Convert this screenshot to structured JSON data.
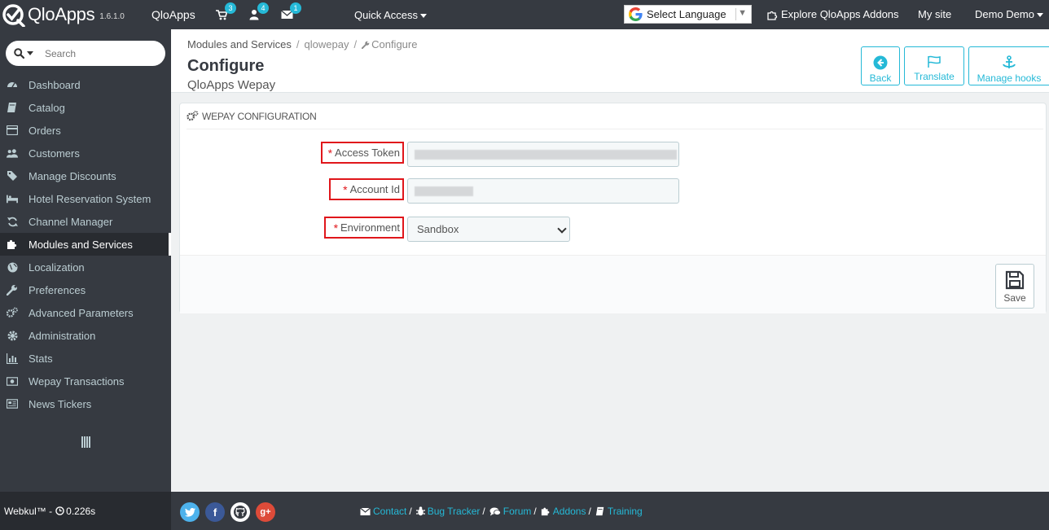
{
  "topbar": {
    "logo_text": "QloApps",
    "version": "1.6.1.0",
    "shop_name": "QloApps",
    "notifications": [
      {
        "icon": "cart-icon",
        "count": "3"
      },
      {
        "icon": "user-icon",
        "count": "4"
      },
      {
        "icon": "envelope-icon",
        "count": "1"
      }
    ],
    "quick_access": "Quick Access",
    "language_select": "Select Language",
    "explore_addons": "Explore QloApps Addons",
    "my_site": "My site",
    "employee": "Demo Demo"
  },
  "sidebar": {
    "search_placeholder": "Search",
    "items": [
      {
        "label": "Dashboard",
        "icon": "dashboard-icon"
      },
      {
        "label": "Catalog",
        "icon": "book-icon"
      },
      {
        "label": "Orders",
        "icon": "credit-card-icon"
      },
      {
        "label": "Customers",
        "icon": "users-icon"
      },
      {
        "label": "Manage Discounts",
        "icon": "tags-icon"
      },
      {
        "label": "Hotel Reservation System",
        "icon": "bed-icon"
      },
      {
        "label": "Channel Manager",
        "icon": "refresh-icon"
      },
      {
        "label": "Modules and Services",
        "icon": "puzzle-icon",
        "active": true
      },
      {
        "label": "Localization",
        "icon": "globe-icon"
      },
      {
        "label": "Preferences",
        "icon": "wrench-icon"
      },
      {
        "label": "Advanced Parameters",
        "icon": "cogs-icon"
      },
      {
        "label": "Administration",
        "icon": "cog-icon"
      },
      {
        "label": "Stats",
        "icon": "bar-chart-icon"
      },
      {
        "label": "Wepay Transactions",
        "icon": "money-icon"
      },
      {
        "label": "News Tickers",
        "icon": "newspaper-icon"
      }
    ]
  },
  "header": {
    "breadcrumb": [
      "Modules and Services",
      "qlowepay",
      "Configure"
    ],
    "title": "Configure",
    "subtitle": "QloApps Wepay",
    "toolbar": {
      "back": "Back",
      "translate": "Translate",
      "manage_hooks": "Manage hooks"
    }
  },
  "panel": {
    "heading": "WEPAY CONFIGURATION",
    "fields": {
      "access_token_label": "Access Token",
      "account_id_label": "Account Id",
      "environment_label": "Environment",
      "environment_value": "Sandbox",
      "required_mark": "*"
    },
    "save": "Save"
  },
  "footer": {
    "brand": "Webkul™ -",
    "load_time": "0.226s",
    "links": [
      "Contact",
      "Bug Tracker",
      "Forum",
      "Addons",
      "Training"
    ]
  },
  "colors": {
    "topbar": "#363a41",
    "accent": "#25b9d7",
    "required": "#e0161b",
    "twitter": "#4db2ec",
    "facebook": "#3b5998",
    "github": "#363a41",
    "google": "#dd4b39"
  }
}
